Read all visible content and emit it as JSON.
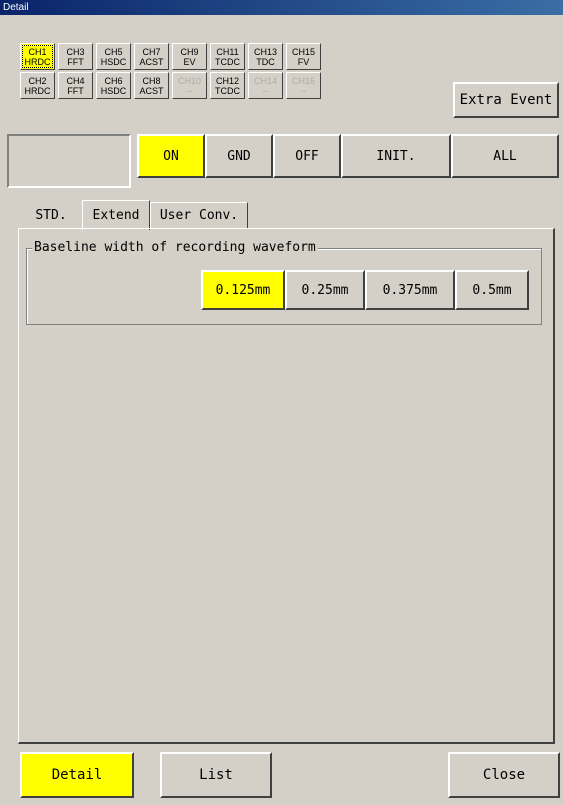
{
  "window": {
    "title": "Detail"
  },
  "channels": {
    "row1": [
      {
        "name": "CH1",
        "type": "HRDC",
        "state": "active"
      },
      {
        "name": "CH3",
        "type": "FFT",
        "state": "normal"
      },
      {
        "name": "CH5",
        "type": "HSDC",
        "state": "normal"
      },
      {
        "name": "CH7",
        "type": "ACST",
        "state": "normal"
      },
      {
        "name": "CH9",
        "type": "EV",
        "state": "normal"
      },
      {
        "name": "CH11",
        "type": "TCDC",
        "state": "normal"
      },
      {
        "name": "CH13",
        "type": "TDC",
        "state": "normal"
      },
      {
        "name": "CH15",
        "type": "FV",
        "state": "normal"
      }
    ],
    "row2": [
      {
        "name": "CH2",
        "type": "HRDC",
        "state": "normal"
      },
      {
        "name": "CH4",
        "type": "FFT",
        "state": "normal"
      },
      {
        "name": "CH6",
        "type": "HSDC",
        "state": "normal"
      },
      {
        "name": "CH8",
        "type": "ACST",
        "state": "normal"
      },
      {
        "name": "CH10",
        "type": "--",
        "state": "disabled"
      },
      {
        "name": "CH12",
        "type": "TCDC",
        "state": "normal"
      },
      {
        "name": "CH14",
        "type": "--",
        "state": "disabled"
      },
      {
        "name": "CH16",
        "type": "--",
        "state": "disabled"
      }
    ],
    "extra_event_label": "Extra Event"
  },
  "controls": {
    "on": "ON",
    "gnd": "GND",
    "off": "OFF",
    "init": "INIT.",
    "all": "ALL"
  },
  "tabs": [
    {
      "label": "STD."
    },
    {
      "label": "Extend"
    },
    {
      "label": "User Conv."
    }
  ],
  "baseline": {
    "group_label": "Baseline width of recording waveform",
    "options": [
      {
        "label": "0.125mm",
        "selected": true
      },
      {
        "label": "0.25mm",
        "selected": false
      },
      {
        "label": "0.375mm",
        "selected": false
      },
      {
        "label": "0.5mm",
        "selected": false
      }
    ]
  },
  "footer": {
    "detail": "Detail",
    "list": "List",
    "close": "Close"
  },
  "colors": {
    "active": "#ffff00",
    "face": "#d4d0c8",
    "title": "#0a246a"
  }
}
